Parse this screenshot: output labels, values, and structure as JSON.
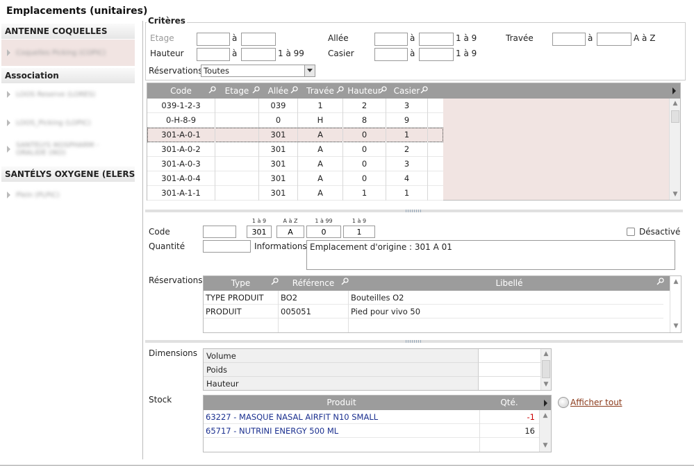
{
  "title": "Emplacements (unitaires)",
  "sidebar": {
    "groups": [
      {
        "label": "ANTENNE COQUELLES",
        "items": [
          "Coquelles Picking (COPIC)"
        ]
      },
      {
        "label": "Association",
        "items": [
          "LOOS Reserve (LORES)",
          "LOOS_Picking (LOPIC)",
          "SANTELYS IKOSPHARM - ORALIDE (IKO)"
        ]
      },
      {
        "label": "SANTÉLYS OXYGENE (ELERS)",
        "items": [
          "Plein (PLPIC)"
        ]
      }
    ]
  },
  "criteres": {
    "legend": "Critères",
    "etage": "Etage",
    "a": "à",
    "allee": "Allée",
    "range_1_9": "1 à 9",
    "travee": "Travée",
    "range_a_z": "A à Z",
    "hauteur": "Hauteur",
    "range_1_99": "1 à 99",
    "casier": "Casier",
    "reservations": "Réservations",
    "reservations_value": "Toutes"
  },
  "grid": {
    "columns": [
      "Code",
      "Etage",
      "Allée",
      "Travée",
      "Hauteur",
      "Casier"
    ],
    "rows": [
      [
        "039-1-2-3",
        "",
        "039",
        "1",
        "2",
        "3"
      ],
      [
        "0-H-8-9",
        "",
        "0",
        "H",
        "8",
        "9"
      ],
      [
        "301-A-0-1",
        "",
        "301",
        "A",
        "0",
        "1"
      ],
      [
        "301-A-0-2",
        "",
        "301",
        "A",
        "0",
        "2"
      ],
      [
        "301-A-0-3",
        "",
        "301",
        "A",
        "0",
        "3"
      ],
      [
        "301-A-0-4",
        "",
        "301",
        "A",
        "0",
        "4"
      ],
      [
        "301-A-1-1",
        "",
        "301",
        "A",
        "1",
        "1"
      ]
    ]
  },
  "detail": {
    "code_label": "Code",
    "hints": [
      "1 à 9",
      "A à Z",
      "1 à 99",
      "1 à 9"
    ],
    "code_parts": [
      "",
      "301",
      "A",
      "0",
      "1"
    ],
    "desactive": "Désactivé",
    "quantite_label": "Quantité",
    "quantite_value": "",
    "informations_label": "Informations",
    "informations_value": "Emplacement d'origine : 301 A 01",
    "reservations_label": "Réservations",
    "res_columns": [
      "Type",
      "Référence",
      "Libellé"
    ],
    "res_rows": [
      [
        "TYPE PRODUIT",
        "BO2",
        "Bouteilles O2"
      ],
      [
        "PRODUIT",
        "005051",
        "Pied pour vivo 50"
      ]
    ],
    "dimensions_label": "Dimensions",
    "dimensions": [
      "Volume",
      "Poids",
      "Hauteur"
    ],
    "stock_label": "Stock",
    "stock_columns": [
      "Produit",
      "Qté."
    ],
    "stock_rows": [
      [
        "63227 - MASQUE NASAL AIRFIT N10 SMALL",
        "-1"
      ],
      [
        "65717 - NUTRINI ENERGY 500 ML",
        "16"
      ]
    ],
    "afficher_tout": "Afficher tout"
  },
  "colors": {
    "header_bg": "#9c9c9c",
    "selected_bg": "#f1e4e2",
    "negative": "#cc0000",
    "link": "#8b3a1a",
    "product": "#1a2f8f"
  }
}
